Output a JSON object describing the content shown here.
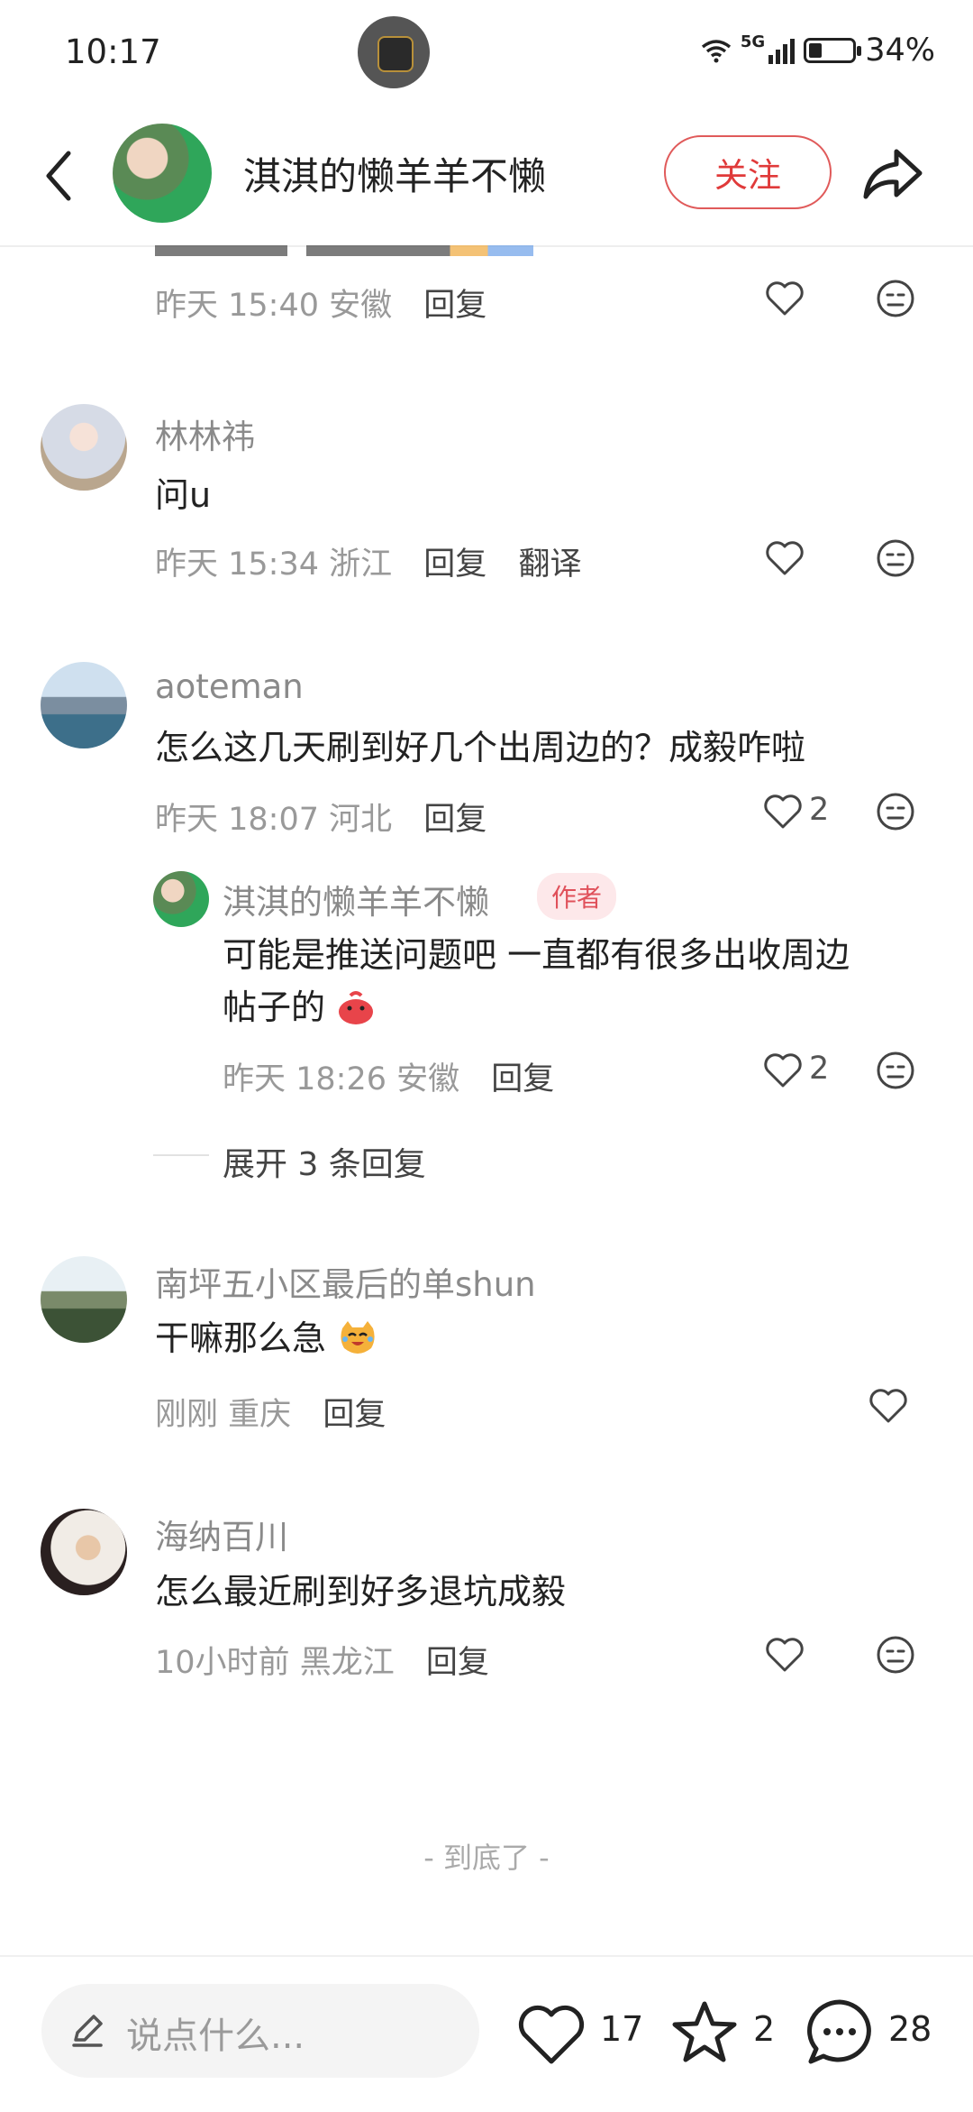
{
  "status_bar": {
    "time": "10:17",
    "network": "5G",
    "battery": "34%"
  },
  "header": {
    "username": "淇淇的懒羊羊不懒",
    "follow_label": "关注",
    "icons": [
      "back-icon",
      "share-icon"
    ]
  },
  "comments": [
    {
      "partial": true,
      "time": "昨天 15:40",
      "location": "安徽",
      "reply_label": "回复"
    },
    {
      "name": "林林祎",
      "text": "问u",
      "time": "昨天 15:34",
      "location": "浙江",
      "reply_label": "回复",
      "translate_label": "翻译"
    },
    {
      "name": "aoteman",
      "text": "怎么这几天刷到好几个出周边的？成毅咋啦",
      "time": "昨天 18:07",
      "location": "河北",
      "reply_label": "回复",
      "likes": "2",
      "reply": {
        "name": "淇淇的懒羊羊不懒",
        "tag": "作者",
        "text_line1": "可能是推送问题吧 一直都有很多出收周边",
        "text_line2": "帖子的",
        "time": "昨天 18:26",
        "location": "安徽",
        "reply_label": "回复",
        "likes": "2"
      },
      "expand_label": "展开 3 条回复"
    },
    {
      "name": "南坪五小区最后的单shun",
      "text": "干嘛那么急",
      "time": "刚刚",
      "location": "重庆",
      "reply_label": "回复"
    },
    {
      "name": "海纳百川",
      "text": "怎么最近刷到好多退坑成毅",
      "time": "10小时前",
      "location": "黑龙江",
      "reply_label": "回复"
    }
  ],
  "end_text": "- 到底了 -",
  "bottom_bar": {
    "input_placeholder": "说点什么...",
    "likes": "17",
    "favorites": "2",
    "comments": "28"
  },
  "colors": {
    "accent_red": "#e03a3a",
    "text_gray": "#999999",
    "text_dark": "#222222"
  }
}
